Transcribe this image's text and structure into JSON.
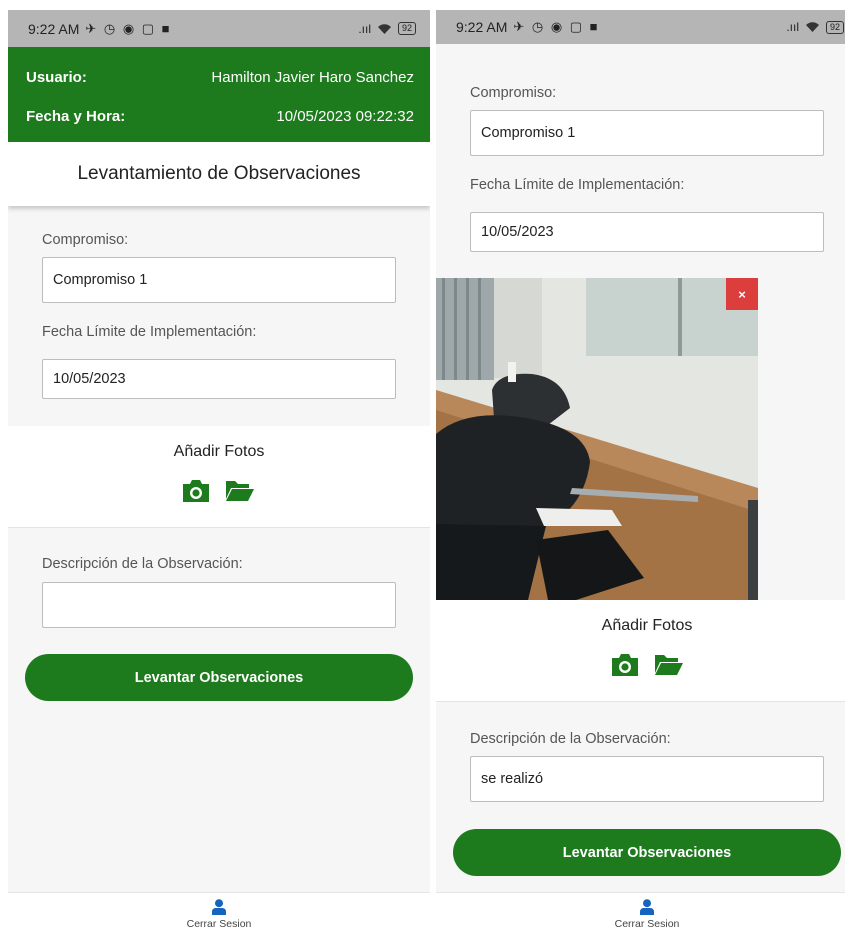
{
  "status_bar": {
    "time": "9:22 AM",
    "notif_icons": "✈ ◷ ◉ ▢ ■",
    "signal": ".ııl",
    "battery": "92"
  },
  "session": {
    "user_label": "Usuario:",
    "user_value": "Hamilton Javier Haro Sanchez",
    "datetime_label": "Fecha y Hora:",
    "datetime_value": "10/05/2023 09:22:32"
  },
  "page_title": "Levantamiento de Observaciones",
  "form": {
    "compromiso_label": "Compromiso:",
    "compromiso_value": "Compromiso 1",
    "fecha_label": "Fecha Límite de Implementación:",
    "fecha_value": "10/05/2023",
    "add_photos_label": "Añadir Fotos",
    "descripcion_label": "Descripción de la Observación:",
    "descripcion_value_left": "",
    "descripcion_value_right": "se realizó",
    "submit_label": "Levantar Observaciones"
  },
  "photo": {
    "remove_label": "×"
  },
  "bottom_nav": {
    "logout_label": "Cerrar Sesion"
  },
  "colors": {
    "primary": "#1d7a1d",
    "danger": "#dc3d3d",
    "status_bar": "#b5b5b5"
  },
  "icons": [
    "camera-icon",
    "folder-open-icon",
    "user-icon"
  ]
}
